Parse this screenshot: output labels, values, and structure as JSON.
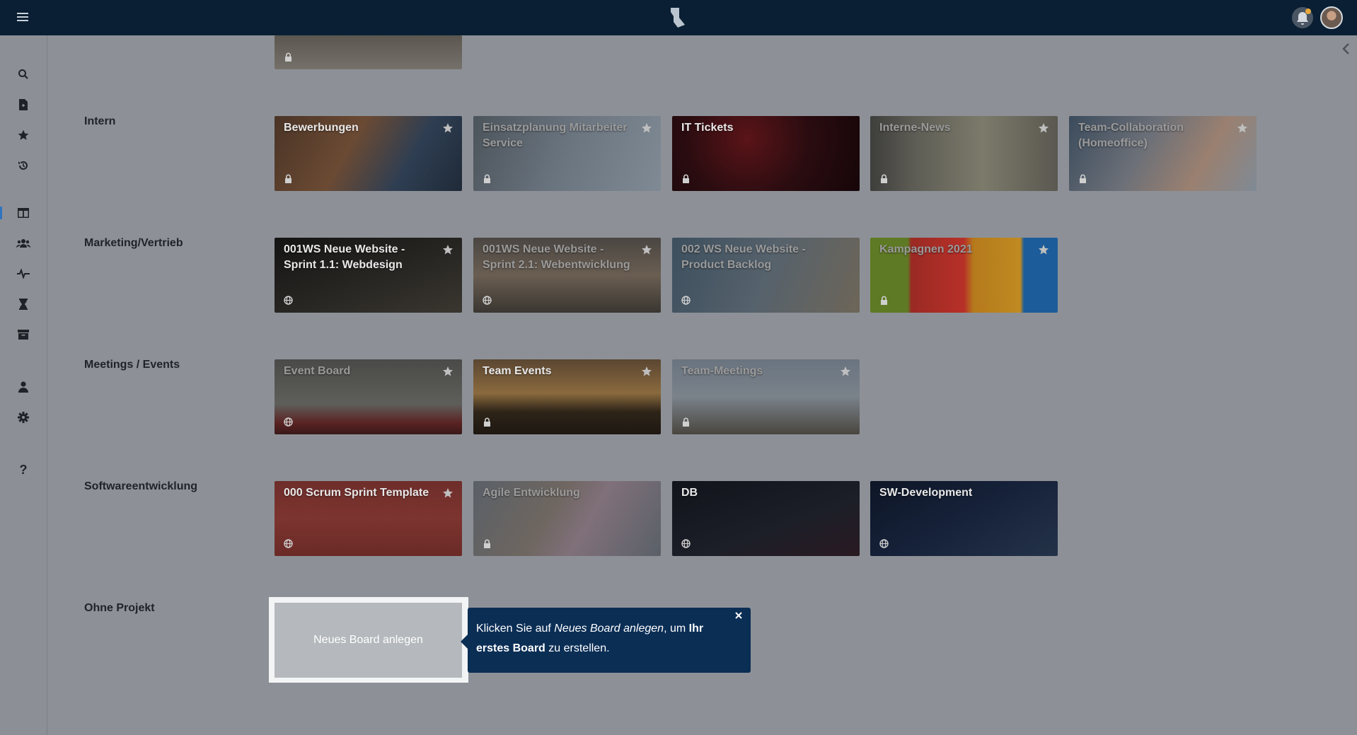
{
  "topbar": {
    "menu_icon": "hamburger-icon",
    "logo_icon": "app-logo-icon",
    "bell_icon": "bell-icon",
    "avatar": "user-avatar"
  },
  "sidebar": {
    "items": [
      {
        "name": "search-icon"
      },
      {
        "name": "new-document-icon"
      },
      {
        "name": "star-icon"
      },
      {
        "name": "history-icon"
      },
      {
        "name": "boards-icon"
      },
      {
        "name": "team-icon"
      },
      {
        "name": "activity-icon"
      },
      {
        "name": "hourglass-icon"
      },
      {
        "name": "archive-icon"
      },
      {
        "name": "user-icon"
      },
      {
        "name": "settings-icon"
      },
      {
        "name": "help-icon"
      }
    ]
  },
  "sections": [
    {
      "label": "Intern",
      "boards": [
        {
          "title": "Bewerbungen",
          "visibility": "lock",
          "starred": true
        },
        {
          "title": "Einsatzplanung Mitarbeiter Service",
          "visibility": "lock",
          "starred": true
        },
        {
          "title": "IT Tickets",
          "visibility": "lock",
          "starred": false
        },
        {
          "title": "Interne-News",
          "visibility": "lock",
          "starred": true
        },
        {
          "title": "Team-Collaboration (Homeoffice)",
          "visibility": "lock",
          "starred": true
        }
      ]
    },
    {
      "label": "Marketing/Vertrieb",
      "boards": [
        {
          "title": "001WS Neue Website - Sprint 1.1: Webdesign",
          "visibility": "globe",
          "starred": true
        },
        {
          "title": "001WS Neue Website - Sprint 2.1: Webentwicklung",
          "visibility": "globe",
          "starred": true
        },
        {
          "title": "002 WS Neue Website - Product Backlog",
          "visibility": "globe",
          "starred": false
        },
        {
          "title": "Kampagnen 2021",
          "visibility": "lock",
          "starred": true
        }
      ]
    },
    {
      "label": "Meetings / Events",
      "boards": [
        {
          "title": "Event Board",
          "visibility": "globe",
          "starred": true
        },
        {
          "title": "Team Events",
          "visibility": "lock",
          "starred": true
        },
        {
          "title": "Team-Meetings",
          "visibility": "lock",
          "starred": true
        }
      ]
    },
    {
      "label": "Softwareentwicklung",
      "boards": [
        {
          "title": "000 Scrum Sprint Template",
          "visibility": "globe",
          "starred": true
        },
        {
          "title": "Agile Entwicklung",
          "visibility": "lock",
          "starred": false
        },
        {
          "title": "DB",
          "visibility": "globe",
          "starred": false
        },
        {
          "title": "SW-Development",
          "visibility": "globe",
          "starred": false
        }
      ]
    },
    {
      "label": "Ohne Projekt",
      "boards": []
    }
  ],
  "new_board": {
    "label": "Neues Board anlegen"
  },
  "tooltip": {
    "part1": "Klicken Sie auf ",
    "part2": "Neues Board anlegen",
    "part3": ", um ",
    "part4": "Ihr erstes Board",
    "part5": " zu erstellen.",
    "close_icon": "close-icon"
  },
  "colors": {
    "topbar": "#0a1f33",
    "overlay": "#8d9197",
    "tooltip": "#0b2e55"
  }
}
